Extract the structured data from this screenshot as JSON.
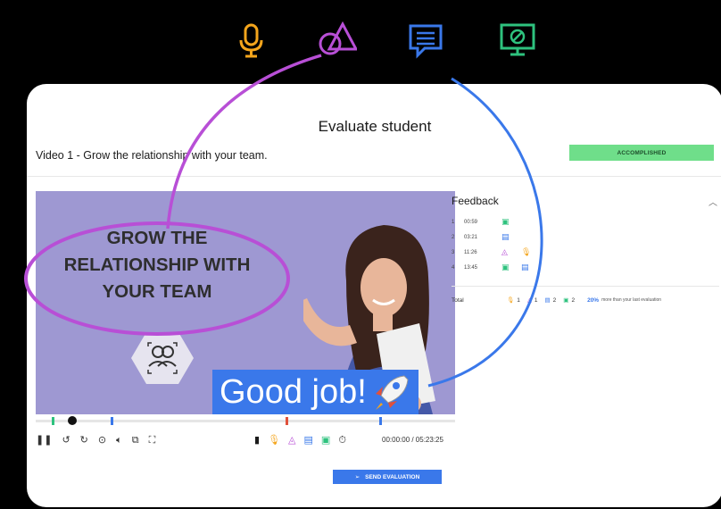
{
  "colors": {
    "mic": "#f4a51c",
    "shapes": "#b84fd6",
    "chat": "#3a78ea",
    "screen": "#2ec27e",
    "accomplished": "#6fde8a",
    "primary": "#3a78ea"
  },
  "top_icons": [
    "microphone-icon",
    "shapes-icon",
    "chat-icon",
    "screen-icon"
  ],
  "page": {
    "title": "Evaluate student",
    "video_title": "Video 1 - Grow the relationship with your team.",
    "status_badge": "ACCOMPLISHED"
  },
  "video": {
    "headline_line1": "GROW THE",
    "headline_line2": "RELATIONSHIP WITH",
    "headline_line3": "YOUR TEAM",
    "overlay_text": "Good job!",
    "time": "00:00:00 / 05:23:25"
  },
  "feedback": {
    "title": "Feedback",
    "rows": [
      {
        "num": "1",
        "time": "00:59"
      },
      {
        "num": "2",
        "time": "03:21"
      },
      {
        "num": "3",
        "time": "11:26"
      },
      {
        "num": "4",
        "time": "13:45"
      }
    ],
    "total_label": "Total",
    "totals": [
      "1",
      "1",
      "2",
      "2"
    ],
    "improvement_bold": "20%",
    "improvement_text": "more than your last evaluation"
  },
  "actions": {
    "send_label": "SEND EVALUATION"
  }
}
